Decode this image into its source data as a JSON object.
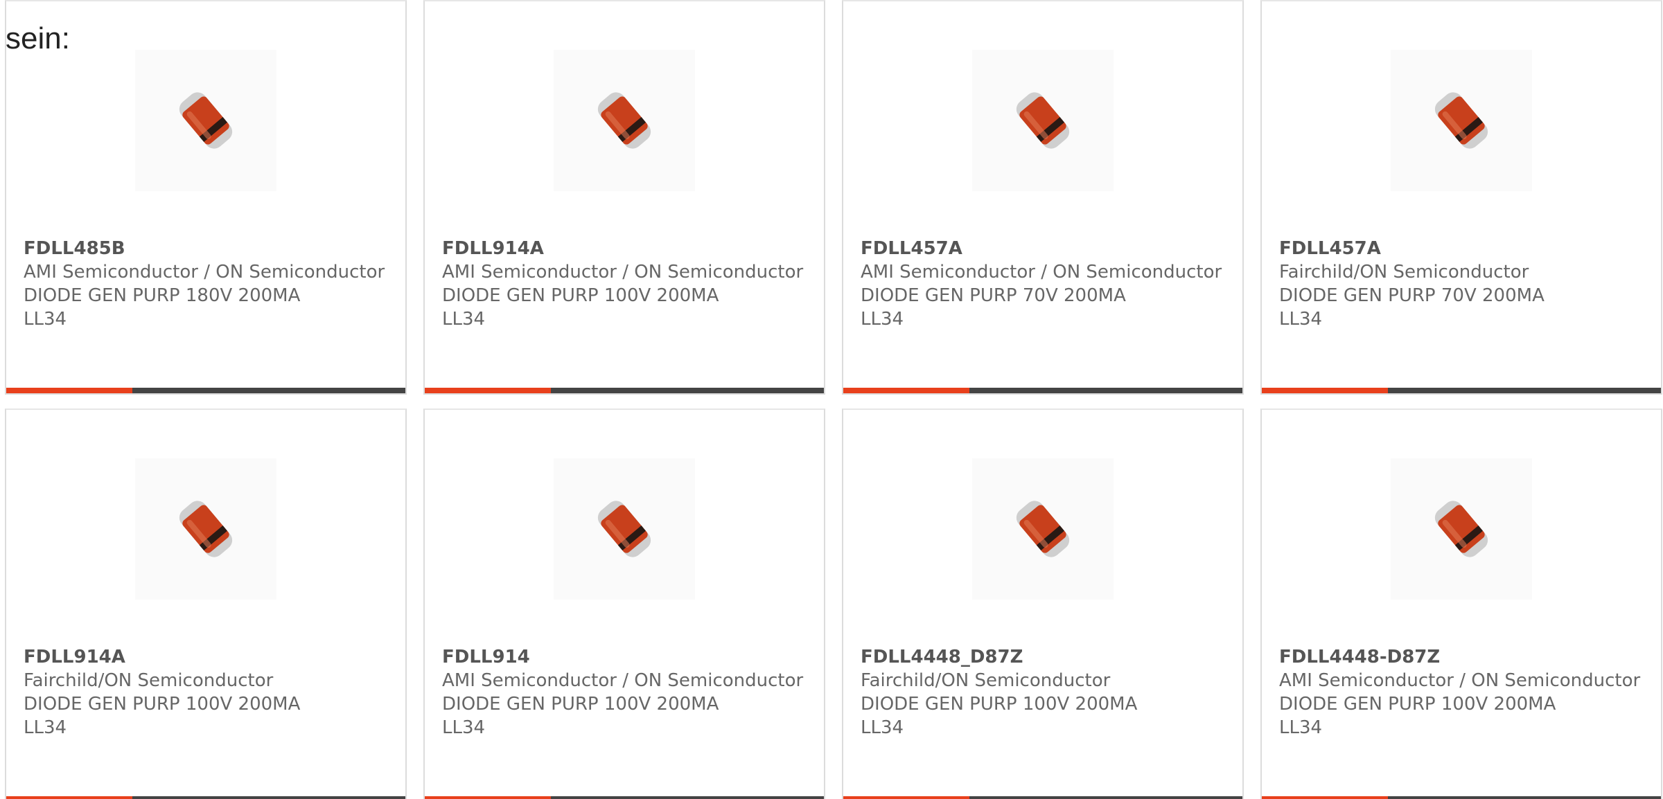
{
  "intro_text": "sein:",
  "colors": {
    "accent": "#e8401c",
    "bar": "#444444",
    "text": "#666666"
  },
  "products": [
    {
      "part": "FDLL485B",
      "manufacturer": "AMI Semiconductor / ON Semiconductor",
      "description": "DIODE GEN PURP 180V 200MA LL34",
      "image_icon": "diode-image"
    },
    {
      "part": "FDLL914A",
      "manufacturer": "AMI Semiconductor / ON Semiconductor",
      "description": "DIODE GEN PURP 100V 200MA LL34",
      "image_icon": "diode-image"
    },
    {
      "part": "FDLL457A",
      "manufacturer": "AMI Semiconductor / ON Semiconductor",
      "description": "DIODE GEN PURP 70V 200MA LL34",
      "image_icon": "diode-image"
    },
    {
      "part": "FDLL457A",
      "manufacturer": "Fairchild/ON Semiconductor",
      "description": "DIODE GEN PURP 70V 200MA LL34",
      "image_icon": "diode-image"
    },
    {
      "part": "FDLL914A",
      "manufacturer": "Fairchild/ON Semiconductor",
      "description": "DIODE GEN PURP 100V 200MA LL34",
      "image_icon": "diode-image"
    },
    {
      "part": "FDLL914",
      "manufacturer": "AMI Semiconductor / ON Semiconductor",
      "description": "DIODE GEN PURP 100V 200MA LL34",
      "image_icon": "diode-image"
    },
    {
      "part": "FDLL4448_D87Z",
      "manufacturer": "Fairchild/ON Semiconductor",
      "description": "DIODE GEN PURP 100V 200MA LL34",
      "image_icon": "diode-image"
    },
    {
      "part": "FDLL4448-D87Z",
      "manufacturer": "AMI Semiconductor / ON Semiconductor",
      "description": "DIODE GEN PURP 100V 200MA LL34",
      "image_icon": "diode-image"
    }
  ]
}
